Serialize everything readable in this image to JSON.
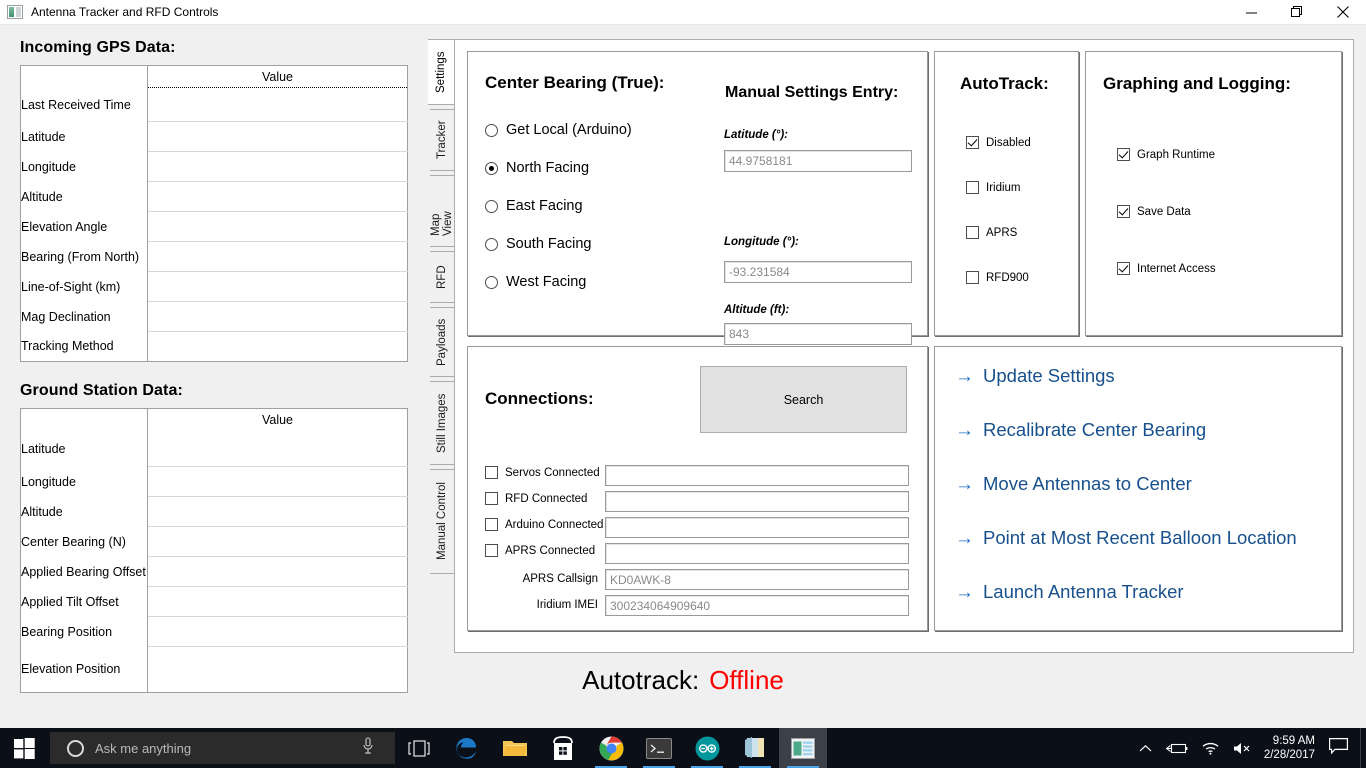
{
  "window": {
    "title": "Antenna Tracker and RFD Controls",
    "icon": "app-window-icon",
    "controls": {
      "minimize": "minimize-icon",
      "maximize": "maximize-icon",
      "close": "close-icon"
    }
  },
  "left_panel": {
    "gps": {
      "title": "Incoming GPS Data:",
      "value_header": "Value",
      "rows": [
        {
          "label": "Last Received Time",
          "value": "",
          "focused": true
        },
        {
          "label": "Latitude",
          "value": ""
        },
        {
          "label": "Longitude",
          "value": ""
        },
        {
          "label": "Altitude",
          "value": ""
        },
        {
          "label": "Elevation Angle",
          "value": ""
        },
        {
          "label": "Bearing (From North)",
          "value": ""
        },
        {
          "label": "Line-of-Sight (km)",
          "value": ""
        },
        {
          "label": "Mag Declination",
          "value": ""
        },
        {
          "label": "Tracking Method",
          "value": ""
        }
      ]
    },
    "ground_station": {
      "title": "Ground Station Data:",
      "value_header": "Value",
      "rows": [
        {
          "label": "Latitude",
          "value": ""
        },
        {
          "label": "Longitude",
          "value": ""
        },
        {
          "label": "Altitude",
          "value": ""
        },
        {
          "label": "Center Bearing (N)",
          "value": ""
        },
        {
          "label": "Applied Bearing Offset",
          "value": ""
        },
        {
          "label": "Applied Tilt Offset",
          "value": ""
        },
        {
          "label": "Bearing Position",
          "value": ""
        },
        {
          "label": "Elevation Position",
          "value": ""
        }
      ]
    }
  },
  "tabs": [
    {
      "label": "Settings",
      "active": true
    },
    {
      "label": "Tracker",
      "active": false
    },
    {
      "label": "Map View",
      "active": false
    },
    {
      "label": "RFD",
      "active": false
    },
    {
      "label": "Payloads",
      "active": false
    },
    {
      "label": "Still Images",
      "active": false
    },
    {
      "label": "Manual Control",
      "active": false
    }
  ],
  "center_bearing": {
    "title": "Center Bearing (True):",
    "options": [
      {
        "label": "Get Local (Arduino)",
        "selected": false
      },
      {
        "label": "North Facing",
        "selected": true
      },
      {
        "label": "East Facing",
        "selected": false
      },
      {
        "label": "South Facing",
        "selected": false
      },
      {
        "label": "West Facing",
        "selected": false
      }
    ]
  },
  "manual_settings": {
    "title": "Manual Settings Entry:",
    "fields": [
      {
        "label": "Latitude (°):",
        "value": "44.9758181"
      },
      {
        "label": "Longitude (°):",
        "value": "-93.231584"
      },
      {
        "label": "Altitude (ft):",
        "value": "843"
      }
    ]
  },
  "autotrack_panel": {
    "title": "AutoTrack:",
    "options": [
      {
        "label": "Disabled",
        "checked": true
      },
      {
        "label": "Iridium",
        "checked": false
      },
      {
        "label": "APRS",
        "checked": false
      },
      {
        "label": "RFD900",
        "checked": false
      }
    ]
  },
  "graphing_panel": {
    "title": "Graphing and Logging:",
    "options": [
      {
        "label": "Graph Runtime",
        "checked": true
      },
      {
        "label": "Save Data",
        "checked": true
      },
      {
        "label": "Internet Access",
        "checked": true
      }
    ]
  },
  "connections": {
    "title": "Connections:",
    "search_button": "Search",
    "checks": [
      {
        "label": "Servos Connected",
        "checked": false,
        "value": ""
      },
      {
        "label": "RFD Connected",
        "checked": false,
        "value": ""
      },
      {
        "label": "Arduino Connected",
        "checked": false,
        "value": ""
      },
      {
        "label": "APRS Connected",
        "checked": false,
        "value": ""
      }
    ],
    "entries": [
      {
        "label": "APRS Callsign",
        "value": "KD0AWK-8"
      },
      {
        "label": "Iridium IMEI",
        "value": "300234064909640"
      }
    ]
  },
  "actions": [
    {
      "label": "Update Settings",
      "arrow": "→"
    },
    {
      "label": "Recalibrate Center Bearing",
      "arrow": "→"
    },
    {
      "label": "Move Antennas to Center",
      "arrow": "→"
    },
    {
      "label": "Point at Most Recent Balloon Location",
      "arrow": "→"
    },
    {
      "label": "Launch Antenna Tracker",
      "arrow": "→"
    }
  ],
  "status": {
    "label": "Autotrack:",
    "value": "Offline",
    "color": "#ff0000"
  },
  "taskbar": {
    "start": "windows-start-icon",
    "search_placeholder": "Ask me anything",
    "mic": "microphone-icon",
    "taskview": "task-view-icon",
    "apps": [
      {
        "name": "edge-icon",
        "running": false,
        "active": false
      },
      {
        "name": "file-explorer-icon",
        "running": false,
        "active": false
      },
      {
        "name": "microsoft-store-icon",
        "running": false,
        "active": false
      },
      {
        "name": "chrome-icon",
        "running": true,
        "active": false
      },
      {
        "name": "command-prompt-icon",
        "running": true,
        "active": false
      },
      {
        "name": "arduino-ide-icon",
        "running": true,
        "active": false
      },
      {
        "name": "notepad-icon",
        "running": true,
        "active": false
      },
      {
        "name": "antenna-tracker-icon",
        "running": true,
        "active": true
      }
    ],
    "tray": {
      "show_hidden": "chevron-up-icon",
      "battery": "battery-charging-icon",
      "network": "wifi-icon",
      "volume": "speaker-mute-icon",
      "time": "9:59 AM",
      "date": "2/28/2017",
      "action_center": "action-center-icon"
    }
  }
}
